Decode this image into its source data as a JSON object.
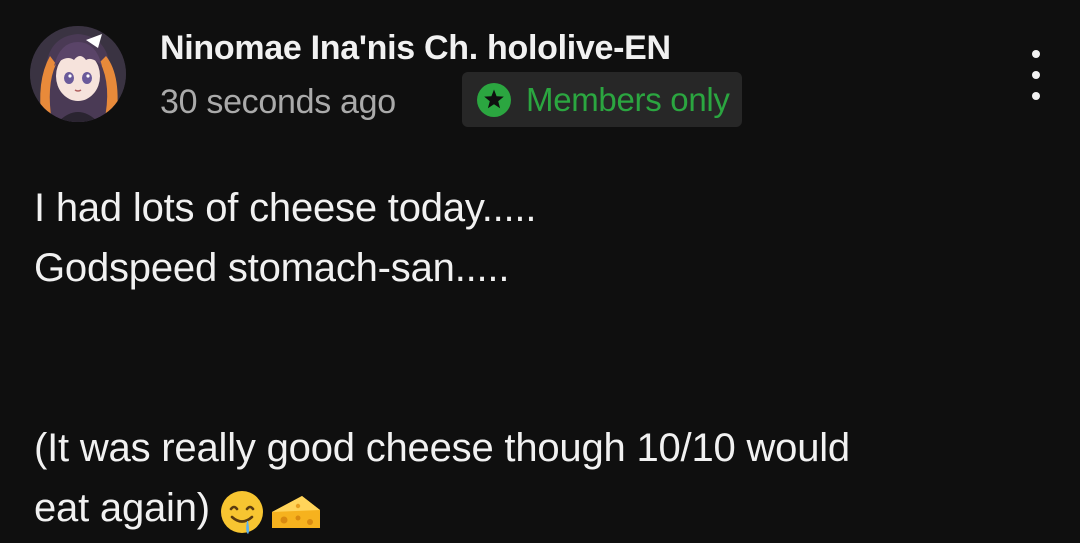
{
  "post": {
    "channel_name": "Ninomae Ina'nis Ch. hololive-EN",
    "timestamp": "30 seconds ago",
    "badge": {
      "label": "Members only",
      "icon": "star-badge-icon",
      "color": "#2ba640"
    },
    "more_icon": "more-vert-icon",
    "body_lines": [
      "I had lots of cheese today.....",
      "Godspeed stomach-san.....",
      "",
      "",
      "(It was really good cheese though 10/10 would",
      "eat again)"
    ],
    "emojis": [
      "drooling-face-emoji",
      "cheese-wedge-emoji"
    ]
  },
  "colors": {
    "background": "#0f0f0f",
    "text_primary": "#f1f1f1",
    "text_secondary": "#aaaaaa",
    "badge_bg": "#272727",
    "accent_green": "#2ba640"
  }
}
